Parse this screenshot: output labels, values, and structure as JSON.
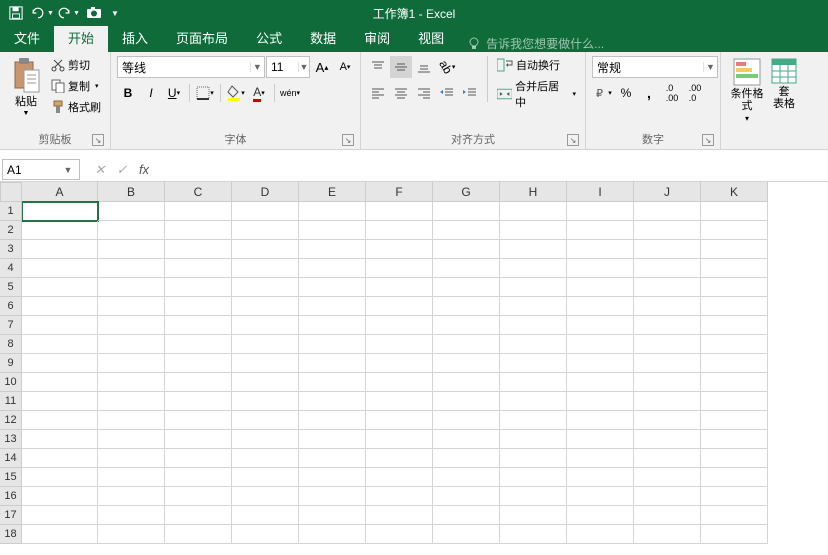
{
  "title": "工作簿1 - Excel",
  "qat": {
    "save": "保存",
    "undo": "撤销",
    "redo": "重做",
    "camera": "相机"
  },
  "tabs": [
    "文件",
    "开始",
    "插入",
    "页面布局",
    "公式",
    "数据",
    "审阅",
    "视图"
  ],
  "active_tab": 1,
  "tell_me": "告诉我您想要做什么...",
  "ribbon": {
    "clipboard": {
      "paste": "粘贴",
      "cut": "剪切",
      "copy": "复制",
      "format_painter": "格式刷",
      "label": "剪贴板"
    },
    "font": {
      "name": "等线",
      "size": "11",
      "label": "字体",
      "wen": "wén"
    },
    "alignment": {
      "wrap": "自动换行",
      "merge": "合并后居中",
      "label": "对齐方式"
    },
    "number": {
      "format": "常规",
      "label": "数字"
    },
    "styles": {
      "cond_format": "条件格式",
      "table_format": "套\n表格",
      "label": ""
    }
  },
  "namebox": "A1",
  "formula": "",
  "columns": [
    "A",
    "B",
    "C",
    "D",
    "E",
    "F",
    "G",
    "H",
    "I",
    "J",
    "K"
  ],
  "rows": [
    1,
    2,
    3,
    4,
    5,
    6,
    7,
    8,
    9,
    10,
    11,
    12,
    13,
    14,
    15,
    16,
    17,
    18
  ],
  "active_cell": "A1"
}
